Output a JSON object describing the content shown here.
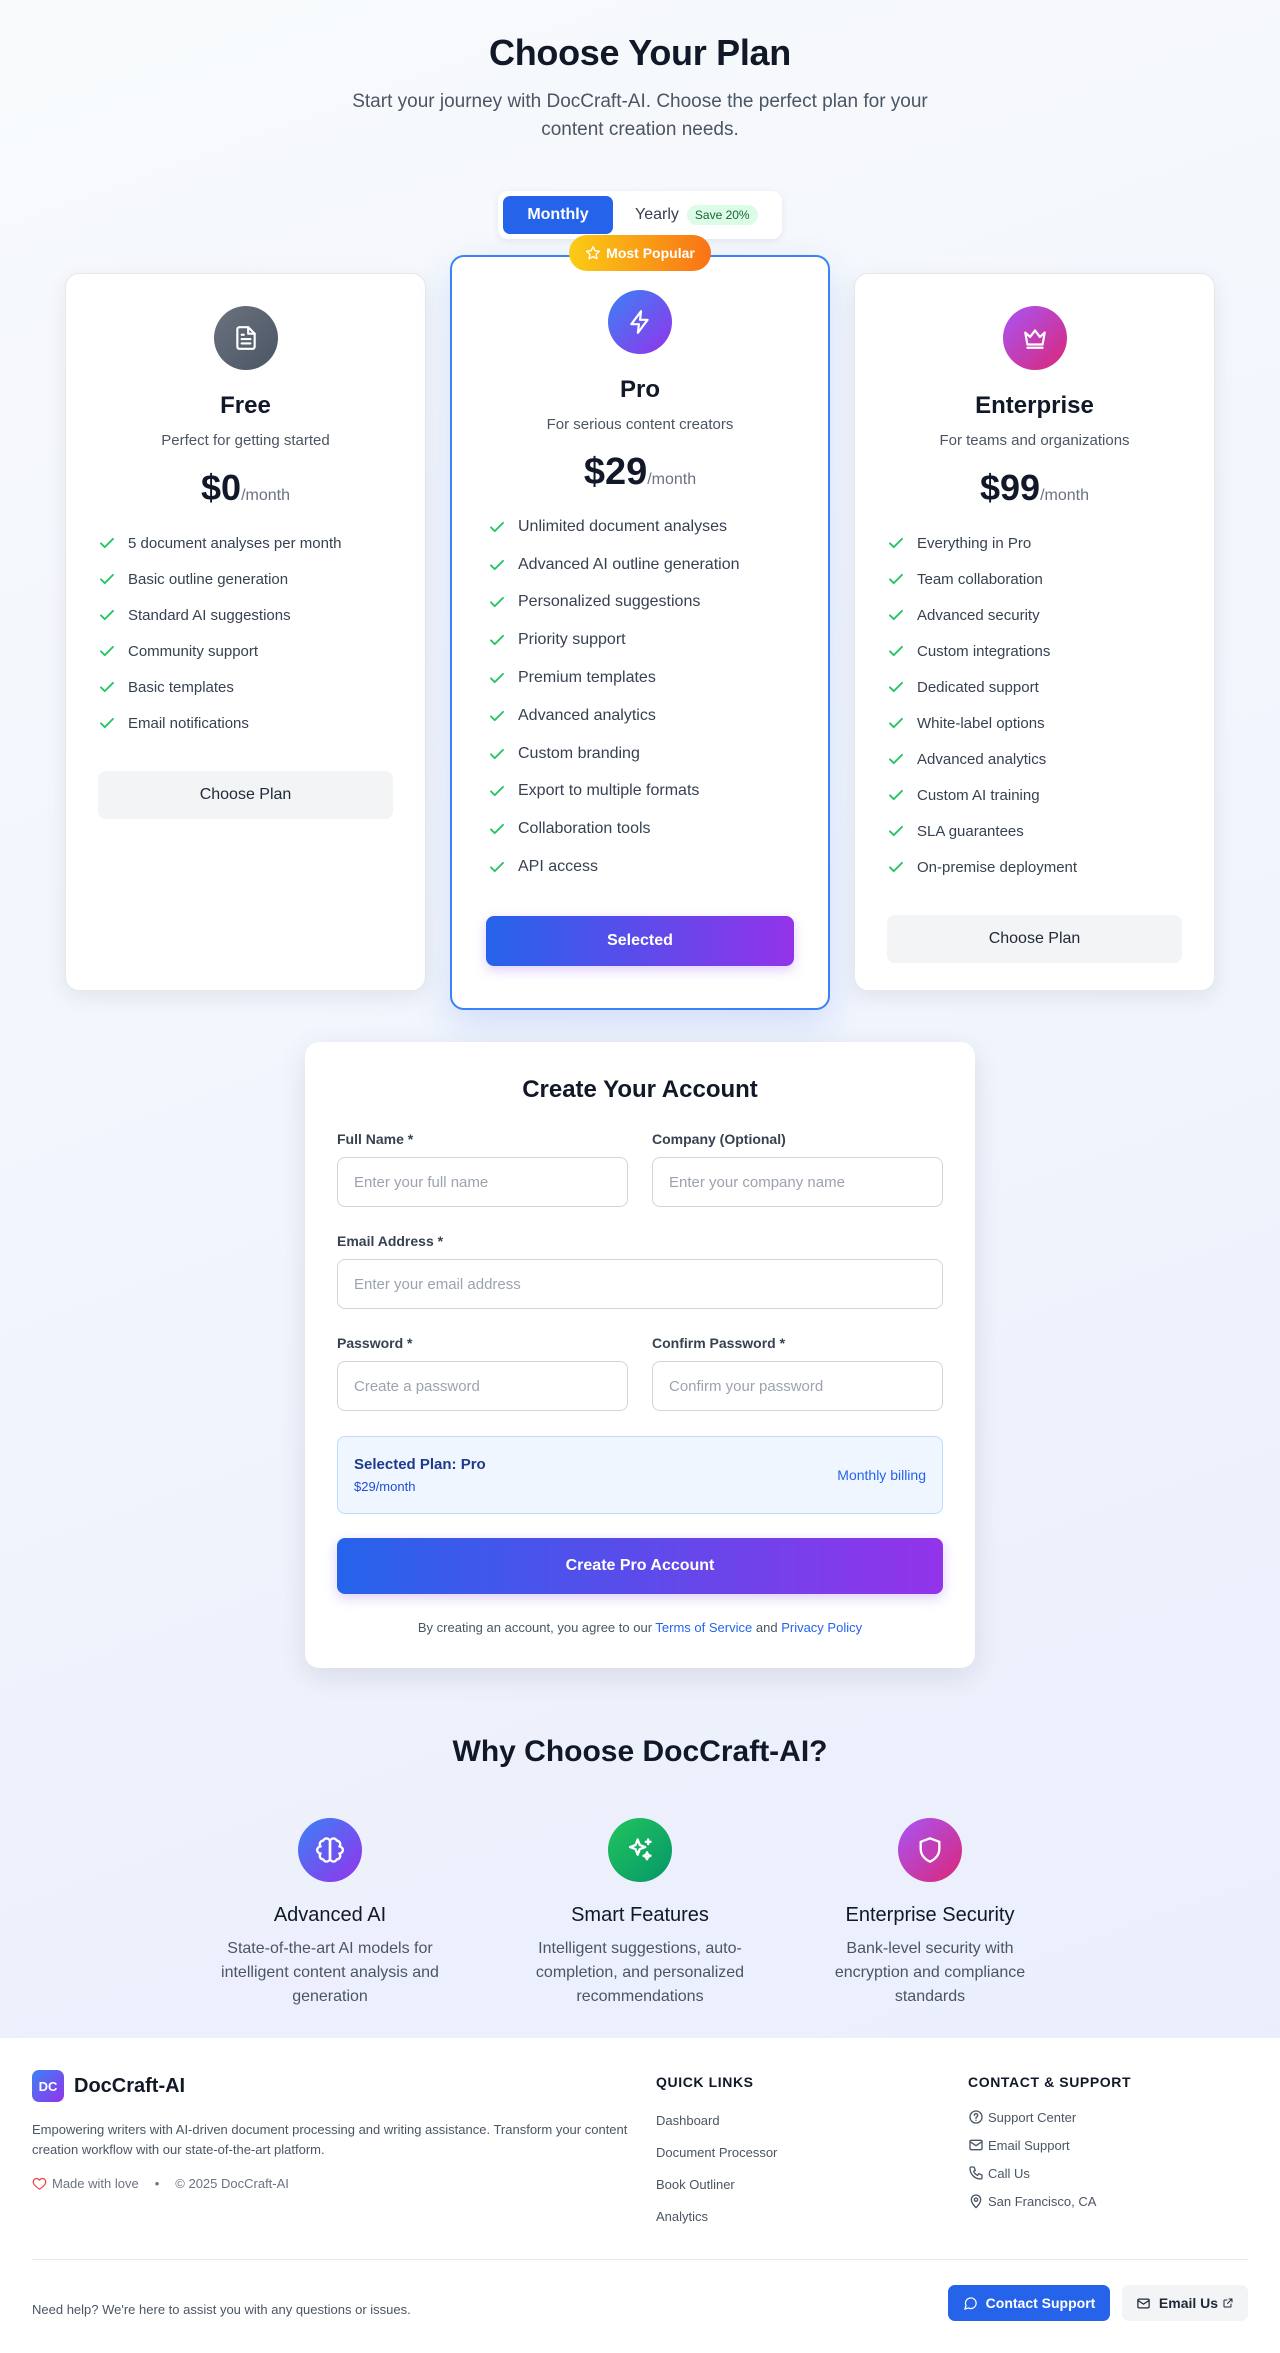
{
  "hero": {
    "title": "Choose Your Plan",
    "subtitle": "Start your journey with DocCraft-AI. Choose the perfect plan for your content creation needs."
  },
  "billing_toggle": {
    "monthly": "Monthly",
    "yearly": "Yearly",
    "save_badge": "Save 20%",
    "selected": "Monthly"
  },
  "popular_badge": "Most Popular",
  "plans": {
    "free": {
      "name": "Free",
      "description": "Perfect for getting started",
      "price": "$0",
      "period": "/month",
      "icon": "document-icon",
      "features": [
        "5 document analyses per month",
        "Basic outline generation",
        "Standard AI suggestions",
        "Community support",
        "Basic templates",
        "Email notifications"
      ],
      "button": "Choose Plan"
    },
    "pro": {
      "name": "Pro",
      "description": "For serious content creators",
      "price": "$29",
      "period": "/month",
      "icon": "lightning-icon",
      "features": [
        "Unlimited document analyses",
        "Advanced AI outline generation",
        "Personalized suggestions",
        "Priority support",
        "Premium templates",
        "Advanced analytics",
        "Custom branding",
        "Export to multiple formats",
        "Collaboration tools",
        "API access"
      ],
      "button": "Selected"
    },
    "enterprise": {
      "name": "Enterprise",
      "description": "For teams and organizations",
      "price": "$99",
      "period": "/month",
      "icon": "crown-icon",
      "features": [
        "Everything in Pro",
        "Team collaboration",
        "Advanced security",
        "Custom integrations",
        "Dedicated support",
        "White-label options",
        "Advanced analytics",
        "Custom AI training",
        "SLA guarantees",
        "On-premise deployment"
      ],
      "button": "Choose Plan"
    }
  },
  "account": {
    "title": "Create Your Account",
    "full_name": {
      "label": "Full Name *",
      "placeholder": "Enter your full name",
      "value": ""
    },
    "company": {
      "label": "Company (Optional)",
      "placeholder": "Enter your company name",
      "value": ""
    },
    "email": {
      "label": "Email Address *",
      "placeholder": "Enter your email address",
      "value": ""
    },
    "password": {
      "label": "Password *",
      "placeholder": "Create a password",
      "value": ""
    },
    "confirm_password": {
      "label": "Confirm Password *",
      "placeholder": "Confirm your password",
      "value": ""
    },
    "selected_plan": {
      "title": "Selected Plan: Pro",
      "price": "$29/month",
      "billing": "Monthly billing"
    },
    "submit": "Create Pro Account",
    "terms_prefix": "By creating an account, you agree to our",
    "terms_link": "Terms of Service",
    "terms_and": "and",
    "privacy_link": "Privacy Policy"
  },
  "why": {
    "title": "Why Choose DocCraft-AI?",
    "items": [
      {
        "title": "Advanced AI",
        "text": "State-of-the-art AI models for intelligent content analysis and generation",
        "icon": "brain-icon"
      },
      {
        "title": "Smart Features",
        "text": "Intelligent suggestions, auto-completion, and personalized recommendations",
        "icon": "sparkles-icon"
      },
      {
        "title": "Enterprise Security",
        "text": "Bank-level security with encryption and compliance standards",
        "icon": "shield-icon"
      }
    ]
  },
  "footer": {
    "logo_text": "DC",
    "brand": "DocCraft-AI",
    "tagline": "Empowering writers with AI-driven document processing and writing assistance. Transform your content creation workflow with our state-of-the-art platform.",
    "made_with": "Made with love",
    "bullet": "•",
    "copyright": "© 2025 DocCraft-AI",
    "quick_links_title": "QUICK LINKS",
    "quick_links": [
      "Dashboard",
      "Document Processor",
      "Book Outliner",
      "Analytics"
    ],
    "contact_title": "CONTACT & SUPPORT",
    "contact": [
      {
        "label": "Support Center",
        "icon": "help-circle-icon"
      },
      {
        "label": "Email Support",
        "icon": "mail-icon"
      },
      {
        "label": "Call Us",
        "icon": "phone-icon"
      },
      {
        "label": "San Francisco, CA",
        "icon": "map-pin-icon"
      }
    ],
    "help_text": "Need help? We're here to assist you with any questions or issues.",
    "contact_button": "Contact Support",
    "email_button": "Email Us"
  },
  "colors": {
    "primary": "#2563eb",
    "accent_purple": "#9333ea",
    "success_check": "#22c55e",
    "popular_start": "#facc15",
    "popular_end": "#f97316"
  }
}
